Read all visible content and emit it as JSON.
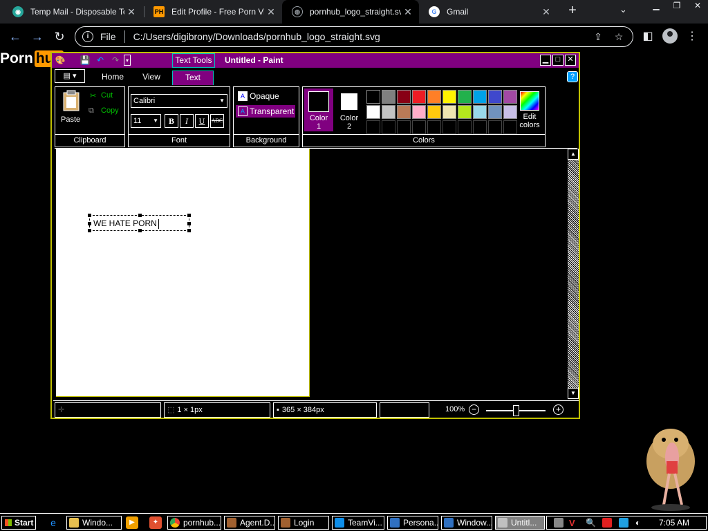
{
  "browser": {
    "tabs": [
      {
        "title": "Temp Mail - Disposable Temp",
        "favicon": "tempmail-icon",
        "color": "#26a69a"
      },
      {
        "title": "Edit Profile - Free Porn Vide",
        "favicon": "PH",
        "color": "#ff9900"
      },
      {
        "title": "pornhub_logo_straight.svg",
        "favicon": "globe-icon",
        "color": "#9aa0a6"
      },
      {
        "title": "Gmail",
        "favicon": "G",
        "color": "#ffffff"
      }
    ],
    "address": {
      "scheme_label": "File",
      "url": "C:/Users/digibrony/Downloads/pornhub_logo_straight.svg"
    }
  },
  "page_logo": {
    "part1": "Porn",
    "part2": "hub"
  },
  "paint": {
    "contextual_tab": "Text Tools",
    "title": "Untitled - Paint",
    "tabs": [
      "Home",
      "View",
      "Text"
    ],
    "clipboard": {
      "paste": "Paste",
      "cut": "Cut",
      "copy": "Copy",
      "group": "Clipboard"
    },
    "font": {
      "family": "Calibri",
      "size": "11",
      "bold": "B",
      "italic": "I",
      "underline": "U",
      "strike": "ABC",
      "group": "Font"
    },
    "background": {
      "opaque": "Opaque",
      "transparent": "Transparent",
      "group": "Background"
    },
    "colors": {
      "color1_line1": "Color",
      "color1_line2": "1",
      "color2_line1": "Color",
      "color2_line2": "2",
      "edit_line1": "Edit",
      "edit_line2": "colors",
      "group": "Colors",
      "row1": [
        "#000000",
        "#7f7f7f",
        "#880015",
        "#ed1c24",
        "#ff7f27",
        "#fff200",
        "#22b14c",
        "#00a2e8",
        "#3f48cc",
        "#a349a4"
      ],
      "row2": [
        "#ffffff",
        "#c3c3c3",
        "#b97a57",
        "#ffaec9",
        "#ffc90e",
        "#efe4b0",
        "#b5e61d",
        "#99d9ea",
        "#7092be",
        "#c8bfe7"
      ]
    },
    "canvas_text": "WE HATE PORN",
    "status": {
      "selection": "1 × 1px",
      "size": "365 × 384px",
      "zoom": "100%"
    }
  },
  "taskbar": {
    "start": "Start",
    "tasks": [
      "Windo...",
      "pornhub...",
      "Agent.D...",
      "Login",
      "TeamVi...",
      "Persona...",
      "Window...",
      "Untitl..."
    ],
    "clock": "7:05 AM"
  }
}
